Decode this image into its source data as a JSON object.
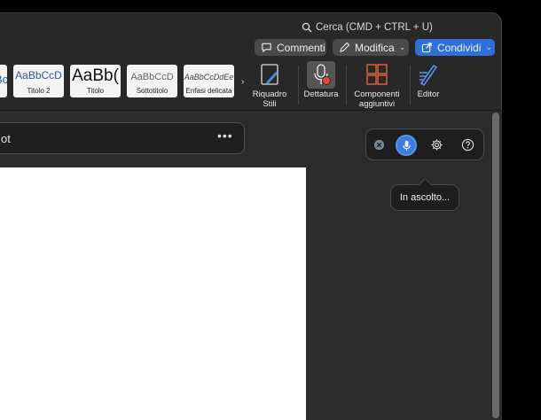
{
  "search": {
    "label": "Cerca (CMD + CTRL + U)"
  },
  "toolbar": {
    "comments_label": "Commenti",
    "edit_label": "Modifica",
    "share_label": "Condividi"
  },
  "ribbon": {
    "styles": [
      {
        "sample": "Bc",
        "label": ""
      },
      {
        "sample": "AaBbCcD",
        "label": "Titolo 2"
      },
      {
        "sample": "AaBb(",
        "label": "Titolo"
      },
      {
        "sample": "AaBbCcD",
        "label": "Sottotitolo"
      },
      {
        "sample": "AaBbCcDdEe",
        "label": "Enfasi delicata"
      }
    ],
    "tools": [
      {
        "label_line1": "Riquadro",
        "label_line2": "Stili"
      },
      {
        "label_line1": "Dettatura",
        "label_line2": ""
      },
      {
        "label_line1": "Componenti",
        "label_line2": "aggiuntivi"
      },
      {
        "label_line1": "Editor",
        "label_line2": ""
      }
    ]
  },
  "document": {
    "title": "ot",
    "more": "•••"
  },
  "dictation": {
    "status": "In ascolto..."
  },
  "colors": {
    "accent": "#2f6fdc",
    "mic": "#3d7be0",
    "record": "#e0483e"
  }
}
